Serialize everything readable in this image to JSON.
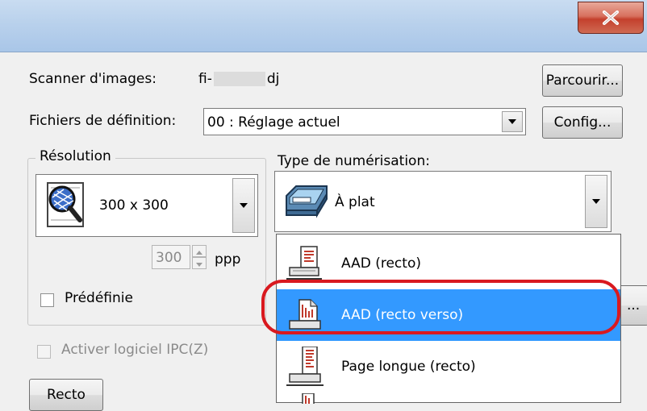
{
  "window": {
    "close_label": "X"
  },
  "scanner": {
    "label": "Scanner d'images:",
    "model_prefix": "fi-",
    "model_suffix": "dj",
    "browse_button": "Parcourir..."
  },
  "definition": {
    "label": "Fichiers de définition:",
    "value": "00 : Réglage actuel",
    "config_button": "Config..."
  },
  "resolution": {
    "group_label": "Résolution",
    "selected": "300 x 300",
    "spin_value": "300",
    "unit": "ppp",
    "preset_label": "Prédéfinie"
  },
  "scan_type": {
    "label": "Type de numérisation:",
    "selected": "À plat",
    "options": [
      {
        "label": "AAD (recto)",
        "icon": "adf-simplex-icon",
        "selected": false
      },
      {
        "label": "AAD (recto verso)",
        "icon": "adf-duplex-icon",
        "selected": true
      },
      {
        "label": "Page longue (recto)",
        "icon": "long-page-icon",
        "selected": false
      }
    ]
  },
  "ipc": {
    "label": "Activer logiciel IPC(Z)"
  },
  "side_button": "Recto",
  "partial_button": "...",
  "colors": {
    "selection": "#3399ff",
    "highlight_ring": "#d9191f"
  }
}
